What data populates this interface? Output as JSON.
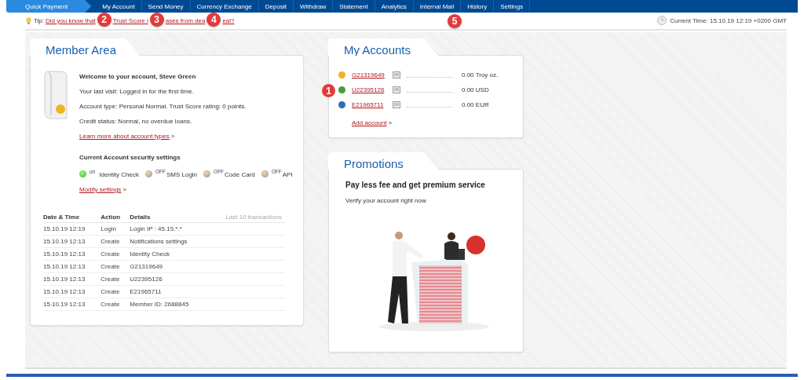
{
  "nav": {
    "items": [
      {
        "label": "Quick Payment",
        "selected": true
      },
      {
        "label": "My Account",
        "selected": false
      },
      {
        "label": "Send Money",
        "selected": false
      },
      {
        "label": "Currency Exchange",
        "selected": false
      },
      {
        "label": "Deposit",
        "selected": false
      },
      {
        "label": "Withdraw",
        "selected": false
      },
      {
        "label": "Statement",
        "selected": false
      },
      {
        "label": "Analytics",
        "selected": false
      },
      {
        "label": "Internal Mail",
        "selected": false
      },
      {
        "label": "History",
        "selected": false
      },
      {
        "label": "Settings",
        "selected": false
      }
    ]
  },
  "tip": {
    "label": "Tip:",
    "link_parts": [
      "Did you know that",
      "Trust Score i",
      "ases from dea",
      "eal?"
    ],
    "markers": [
      "2",
      "3",
      "4",
      "5"
    ]
  },
  "current_time": "Current Time: 15.10.19 12:19 +0200 GMT",
  "member_area": {
    "title": "Member Area",
    "welcome": "Welcome to your account, Steve Green",
    "lines": [
      "Your last visit: Logged in for the first time.",
      "Account type: Personal Normal. Trust Score rating: 0 points.",
      "Credit status: Normal, no overdue loans."
    ],
    "learn_link": "Learn more about account types",
    "learn_chevron": "»",
    "security_title": "Current Account security settings",
    "security": [
      {
        "state_label": "on",
        "label": "Identity Check",
        "on": true
      },
      {
        "state_label": "OFF",
        "label": "SMS Login",
        "on": false
      },
      {
        "state_label": "OFF",
        "label": "Code Card",
        "on": false
      },
      {
        "state_label": "OFF",
        "label": "API",
        "on": false
      }
    ],
    "modify_link": "Modify settings",
    "modify_chevron": "»",
    "transactions": {
      "caption": "Last 10 transactions",
      "columns": [
        "Date & Time",
        "Action",
        "Details"
      ],
      "rows": [
        [
          "15.10.19 12:19",
          "Login",
          "Login IP : 45.15.*.*"
        ],
        [
          "15.10.19 12:13",
          "Create",
          "Notifications settings"
        ],
        [
          "15.10.19 12:13",
          "Create",
          "Identity Check"
        ],
        [
          "15.10.19 12:13",
          "Create",
          "G21319649"
        ],
        [
          "15.10.19 12:13",
          "Create",
          "U22395126"
        ],
        [
          "15.10.19 12:13",
          "Create",
          "E21965711"
        ],
        [
          "15.10.19 12:13",
          "Create",
          "Member ID: 2688845"
        ]
      ]
    }
  },
  "my_accounts": {
    "title": "My Accounts",
    "accounts": [
      {
        "number": "G21319649",
        "balance": "0.00 Troy oz.",
        "color": "#f0b323"
      },
      {
        "number": "U22395126",
        "balance": "0.00 USD",
        "color": "#4a9a3a",
        "marker": "1"
      },
      {
        "number": "E21965711",
        "balance": "0.00 EUR",
        "color": "#2f6db5"
      }
    ],
    "add_link": "Add account",
    "add_chevron": "»"
  },
  "promotions": {
    "title": "Promotions",
    "headline": "Pay less fee and get premium service",
    "text": "Verify your account right now"
  }
}
